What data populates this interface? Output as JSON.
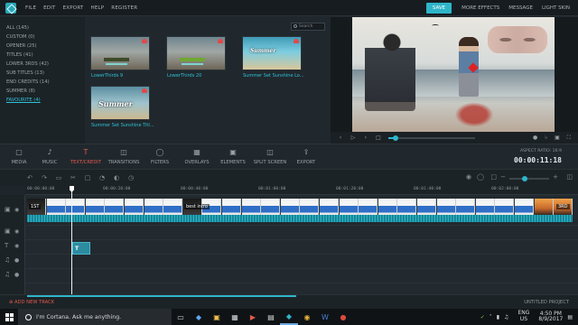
{
  "menu": {
    "items": [
      "FILE",
      "EDIT",
      "EXPORT",
      "HELP",
      "REGISTER"
    ],
    "save_label": "SAVE",
    "links": [
      "MORE EFFECTS",
      "MESSAGE",
      "LIGHT SKIN"
    ]
  },
  "categories": [
    {
      "label": "ALL (145)"
    },
    {
      "label": "CUSTOM (0)"
    },
    {
      "label": "OPENER (25)"
    },
    {
      "label": "TITLES (41)"
    },
    {
      "label": "LOWER 3RDS (42)"
    },
    {
      "label": "SUB TITLES (13)"
    },
    {
      "label": "END CREDITS (14)"
    },
    {
      "label": "SUMMER (8)"
    },
    {
      "label": "FAVOURITE (4)"
    }
  ],
  "library": {
    "search_placeholder": "Search",
    "items": [
      {
        "label": "LowerThirds 9",
        "text": ""
      },
      {
        "label": "LowerThirds 20",
        "text": ""
      },
      {
        "label": "Summer Set Sunshine Lo...",
        "text": "Summer"
      },
      {
        "label": "Summer Set Sunshine Titl...",
        "text": "Summer"
      }
    ]
  },
  "preview": {
    "playback_progress": 0.08
  },
  "toolbar": {
    "tabs": [
      "MEDIA",
      "MUSIC",
      "TEXT/CREDIT",
      "TRANSITIONS",
      "FILTERS",
      "OVERLAYS",
      "ELEMENTS",
      "SPLIT SCREEN",
      "EXPORT"
    ],
    "active_tab": "TEXT/CREDIT",
    "aspect_ratio": "ASPECT RATIO: 16:9",
    "timecode": "00:00:11:18"
  },
  "ruler": {
    "labels": [
      "00:00:00:00",
      "00:00:20:00",
      "00:00:40:00",
      "00:01:00:00",
      "00:01:20:00",
      "00:01:40:00",
      "00:02:00:00"
    ]
  },
  "timeline": {
    "clip_labels": [
      "1ST",
      "best intro",
      "3RD"
    ],
    "title_clip_label": "T"
  },
  "bottom": {
    "add_track": "ADD NEW TRACK",
    "project_name": "UNTITLED PROJECT"
  },
  "taskbar": {
    "cortana": "I'm Cortana. Ask me anything.",
    "lang": "ENG",
    "region": "US",
    "time": "4:50 PM",
    "date": "8/9/2017"
  },
  "colors": {
    "accent": "#2fb5c9",
    "active_tab": "#e25a4f"
  }
}
